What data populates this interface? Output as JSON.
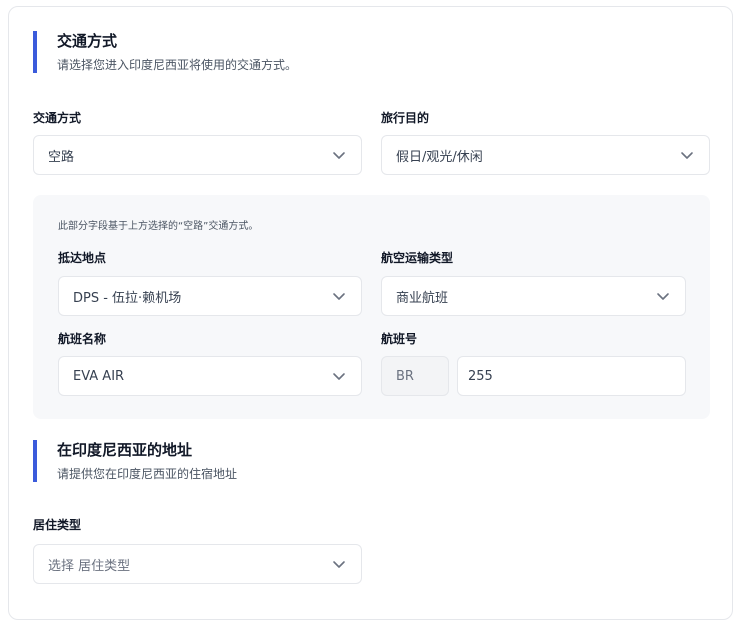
{
  "transport_section": {
    "title": "交通方式",
    "description": "请选择您进入印度尼西亚将使用的交通方式。"
  },
  "transport_mode": {
    "label": "交通方式",
    "value": "空路"
  },
  "travel_purpose": {
    "label": "旅行目的",
    "value": "假日/观光/休闲"
  },
  "air_panel": {
    "hint": "此部分字段基于上方选择的“空路”交通方式。",
    "arrival_point": {
      "label": "抵达地点",
      "value": "DPS - 伍拉·赖机场"
    },
    "air_transport_type": {
      "label": "航空运输类型",
      "value": "商业航班"
    },
    "airline_name": {
      "label": "航班名称",
      "value": "EVA AIR"
    },
    "flight_number": {
      "label": "航班号",
      "prefix": "BR",
      "value": "255"
    }
  },
  "address_section": {
    "title": "在印度尼西亚的地址",
    "description": "请提供您在印度尼西亚的住宿地址"
  },
  "residence_type": {
    "label": "居住类型",
    "placeholder": "选择 居住类型"
  },
  "colors": {
    "accent": "#3b5bdb",
    "border": "#e5e7eb",
    "panel_bg": "#f7f8fa"
  },
  "icons": {
    "dropdown": "chevron-down-icon"
  }
}
